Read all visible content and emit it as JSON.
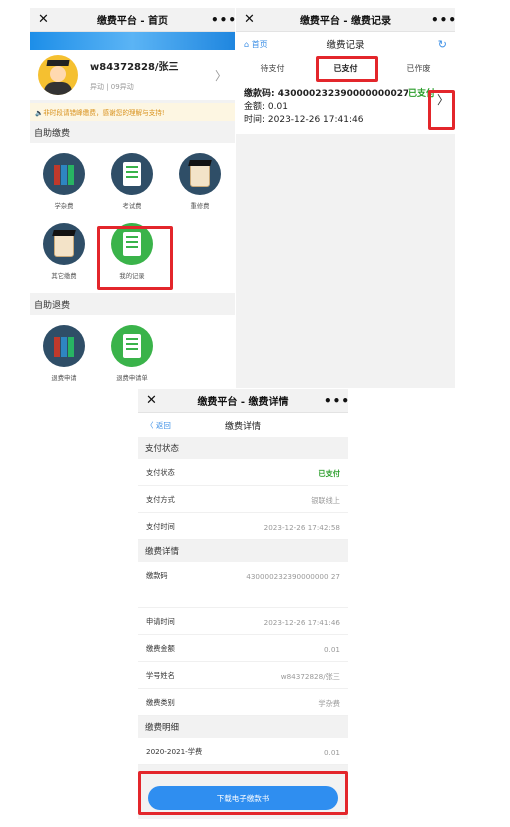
{
  "panel1": {
    "title": "缴费平台 - 首页",
    "profile": {
      "name": "w84372828/张三",
      "status": "异动 | 09异动"
    },
    "notice": "🔈非时段请错峰缴费，感谢您的理解与支持!",
    "self_pay": {
      "title": "自助缴费",
      "items": [
        {
          "label": "学杂费",
          "icon": "books-icon"
        },
        {
          "label": "考试费",
          "icon": "exam-paper-icon"
        },
        {
          "label": "重修费",
          "icon": "diploma-icon"
        },
        {
          "label": "其它缴费",
          "icon": "scroll-icon"
        },
        {
          "label": "我的记录",
          "icon": "records-icon"
        }
      ]
    },
    "self_refund": {
      "title": "自助退费",
      "items": [
        {
          "label": "退费申请",
          "icon": "books-icon"
        },
        {
          "label": "退费申请单",
          "icon": "records-icon"
        }
      ]
    }
  },
  "panel2": {
    "title": "缴费平台 - 缴费记录",
    "home": "⌂ 首页",
    "page_title": "缴费记录",
    "tabs": [
      "待支付",
      "已支付",
      "已作废"
    ],
    "record": {
      "code": "缴款码: 430000232390000000027",
      "amount": "金额: 0.01",
      "time": "时间: 2023-12-26 17:41:46",
      "status": "已支付"
    }
  },
  "panel3": {
    "title": "缴费平台 - 缴费详情",
    "back": "〈 返回",
    "page_title": "缴费详情",
    "pay_status": {
      "title": "支付状态",
      "rows": [
        {
          "label": "支付状态",
          "value": "已支付"
        },
        {
          "label": "支付方式",
          "value": "银联线上"
        },
        {
          "label": "支付时间",
          "value": "2023-12-26 17:42:58"
        }
      ]
    },
    "detail": {
      "title": "缴费详情",
      "rows": [
        {
          "label": "缴款码",
          "value": "430000232390000000 27"
        },
        {
          "label": "申请时间",
          "value": "2023-12-26 17:41:46"
        },
        {
          "label": "缴费金额",
          "value": "0.01"
        },
        {
          "label": "学号姓名",
          "value": "w84372828/张三"
        },
        {
          "label": "缴费类别",
          "value": "学杂费"
        }
      ]
    },
    "items": {
      "title": "缴费明细",
      "rows": [
        {
          "label": "2020-2021-学费",
          "value": "0.01"
        }
      ]
    },
    "download_button": "下载电子缴款书"
  },
  "colors": {
    "accent": "#3a8ee6",
    "highlight": "#e3262b",
    "success": "#2a9d2a",
    "icon_dark": "#2f4e67",
    "icon_green": "#3ab34a"
  }
}
